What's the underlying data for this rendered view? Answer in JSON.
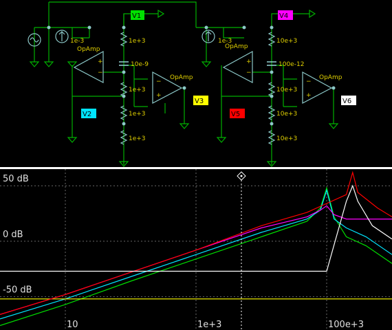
{
  "schematic": {
    "opamp_label": "OpAmp",
    "resistor_value": "1e+3",
    "resistor_value_right": "10e+3",
    "current_source_left": "1e-3",
    "current_source_right": "1e-3",
    "capacitor_left": "10e-9",
    "capacitor_right": "100e-12",
    "probes": [
      {
        "label": "V1",
        "color": "#00e000"
      },
      {
        "label": "V2",
        "color": "#00e5ff"
      },
      {
        "label": "V3",
        "color": "#ffff00"
      },
      {
        "label": "V4",
        "color": "#ff00ff"
      },
      {
        "label": "V5",
        "color": "#ff0000"
      },
      {
        "label": "V6",
        "color": "#ffffff"
      }
    ],
    "wire_color": "#00b000",
    "component_color": "#8cc8c8"
  },
  "chart_data": {
    "type": "line",
    "x_scale": "log",
    "x_ticks": [
      {
        "value": 10,
        "label": "10"
      },
      {
        "value": 1000,
        "label": "1e+3"
      },
      {
        "value": 100000,
        "label": "100e+3"
      }
    ],
    "y_ticks": [
      {
        "value": 50,
        "label": "50 dB"
      },
      {
        "value": 0,
        "label": "0 dB"
      },
      {
        "value": -50,
        "label": "-50 dB"
      }
    ],
    "xlim": [
      1,
      1000000
    ],
    "ylim": [
      -80,
      65
    ],
    "series": [
      {
        "probe": "V1",
        "color": "#00e000",
        "points": [
          [
            1,
            -76
          ],
          [
            10,
            -57
          ],
          [
            100,
            -36
          ],
          [
            1000,
            -16
          ],
          [
            10000,
            4
          ],
          [
            50000,
            18
          ],
          [
            80000,
            30
          ],
          [
            100000,
            48
          ],
          [
            130000,
            22
          ],
          [
            200000,
            4
          ],
          [
            400000,
            -4
          ],
          [
            1000000,
            -20
          ]
        ]
      },
      {
        "probe": "V2",
        "color": "#00e5ff",
        "points": [
          [
            1,
            -70
          ],
          [
            10,
            -52
          ],
          [
            100,
            -32
          ],
          [
            1000,
            -12
          ],
          [
            10000,
            8
          ],
          [
            50000,
            20
          ],
          [
            80000,
            28
          ],
          [
            100000,
            46
          ],
          [
            130000,
            20
          ],
          [
            200000,
            12
          ],
          [
            400000,
            4
          ],
          [
            1000000,
            -12
          ]
        ]
      },
      {
        "probe": "V3",
        "color": "#ffff00",
        "points": [
          [
            1,
            -52
          ],
          [
            1000000,
            -52
          ]
        ]
      },
      {
        "probe": "V4",
        "color": "#ff00ff",
        "points": [
          [
            1,
            -66
          ],
          [
            10,
            -48
          ],
          [
            100,
            -28
          ],
          [
            1000,
            -8
          ],
          [
            10000,
            12
          ],
          [
            50000,
            22
          ],
          [
            80000,
            28
          ],
          [
            100000,
            32
          ],
          [
            130000,
            24
          ],
          [
            200000,
            20
          ],
          [
            1000000,
            20
          ]
        ]
      },
      {
        "probe": "V5",
        "color": "#ff0000",
        "points": [
          [
            1,
            -66
          ],
          [
            10,
            -48
          ],
          [
            100,
            -28
          ],
          [
            1000,
            -8
          ],
          [
            10000,
            14
          ],
          [
            50000,
            26
          ],
          [
            100000,
            34
          ],
          [
            200000,
            42
          ],
          [
            250000,
            62
          ],
          [
            300000,
            44
          ],
          [
            600000,
            30
          ],
          [
            1000000,
            22
          ]
        ]
      },
      {
        "probe": "V6",
        "color": "#ffffff",
        "points": [
          [
            1,
            -27
          ],
          [
            100000,
            -27
          ],
          [
            200000,
            36
          ],
          [
            250000,
            50
          ],
          [
            300000,
            36
          ],
          [
            500000,
            14
          ],
          [
            1000000,
            2
          ]
        ]
      }
    ]
  }
}
